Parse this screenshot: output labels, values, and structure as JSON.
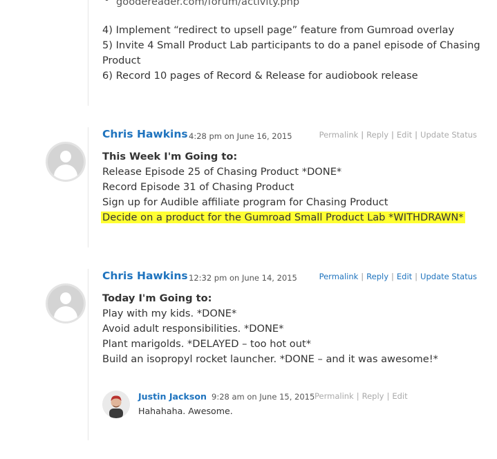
{
  "previous_comment": {
    "bullet_link": "goodereader.com/forum/activity.php",
    "lines": [
      "4) Implement “redirect to upsell page” feature from Gumroad overlay",
      "5) Invite 4 Small Product Lab participants to do a panel episode of Chasing",
      "Product",
      "6) Record 10 pages of Record & Release for audiobook release"
    ]
  },
  "actions_labels": {
    "permalink": "Permalink",
    "reply": "Reply",
    "edit": "Edit",
    "update_status": "Update Status"
  },
  "comments": [
    {
      "author": "Chris Hawkins",
      "time": "4:28 pm",
      "date_prefix": "on June 16, 2015",
      "heading": "This Week I'm Going to:",
      "lines": [
        "Release Episode 25 of Chasing Product *DONE*",
        "Record Episode 31 of Chasing Product",
        "Sign up for Audible affiliate program for Chasing Product"
      ],
      "highlighted_line": "Decide on a product for the Gumroad Small Product Lab *WITHDRAWN*"
    },
    {
      "author": "Chris Hawkins",
      "time": "12:32 pm",
      "date_prefix": "on June 14, 2015",
      "heading": "Today I'm Going to:",
      "lines": [
        "Play with my kids. *DONE*",
        "Avoid adult responsibilities. *DONE*",
        "Plant marigolds. *DELAYED – too hot out*",
        "Build an isopropyl rocket launcher. *DONE – and it was awesome!*"
      ],
      "reply": {
        "author": "Justin Jackson",
        "time": "9:28 am",
        "date_prefix": "on June 15, 2015",
        "text": "Hahahaha. Awesome."
      }
    }
  ],
  "colors": {
    "link": "#1e73be",
    "highlight": "#ffff33",
    "muted": "#aaaaaa"
  }
}
